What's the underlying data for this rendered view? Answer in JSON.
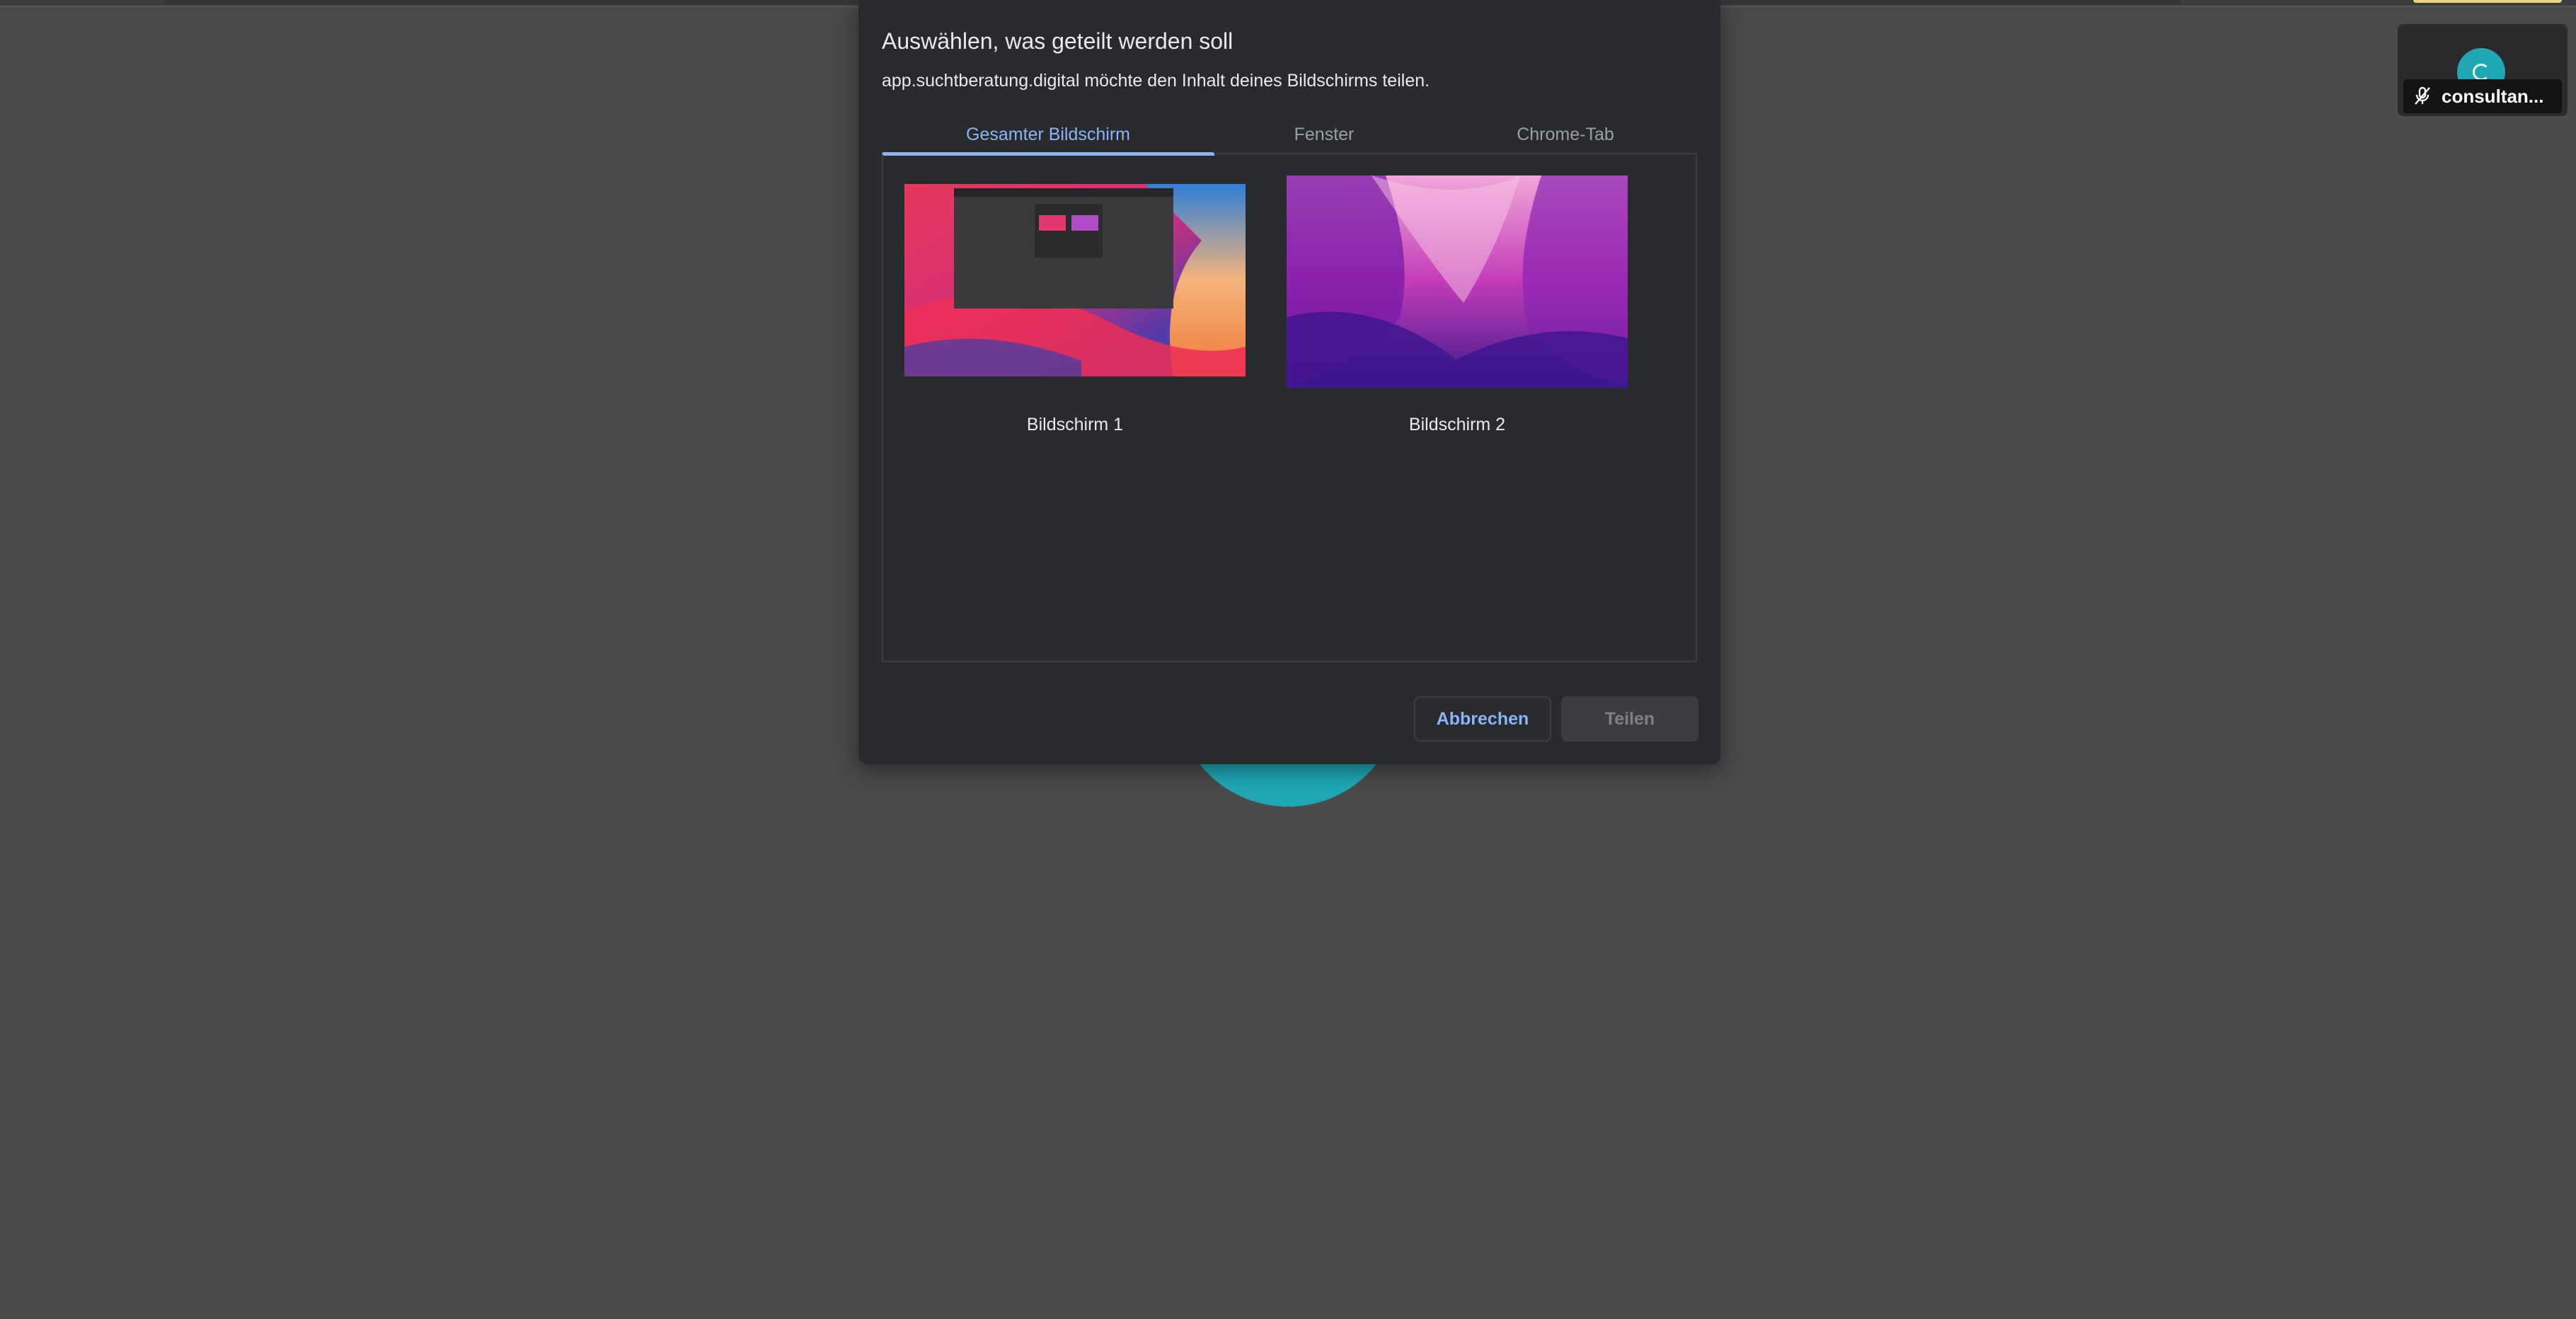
{
  "dialog": {
    "title": "Auswählen, was geteilt werden soll",
    "subtitle": "app.suchtberatung.digital möchte den Inhalt deines Bildschirms teilen.",
    "tabs": [
      {
        "label": "Gesamter Bildschirm",
        "active": true
      },
      {
        "label": "Fenster",
        "active": false
      },
      {
        "label": "Chrome-Tab",
        "active": false
      }
    ],
    "sources": [
      {
        "label": "Bildschirm 1"
      },
      {
        "label": "Bildschirm 2"
      }
    ],
    "buttons": {
      "cancel_label": "Abbrechen",
      "share_label": "Teilen"
    }
  },
  "participant": {
    "name": "consultan...",
    "muted": true,
    "avatar_color": "#1fa8b3"
  },
  "colors": {
    "background": "#4a4a4a",
    "dialog": "#292a2d",
    "accent": "#8ab4f8",
    "teal": "#1fa8b3"
  },
  "icons": [
    "mic-off-icon",
    "loading-spinner-icon"
  ]
}
